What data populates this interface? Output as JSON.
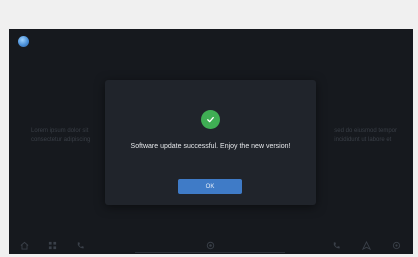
{
  "background": {
    "left_text": [
      "Lorem ipsum dolor sit",
      "consectetur adipiscing"
    ],
    "right_text": [
      "sed do eiusmod tempor",
      "incididunt ut labore et"
    ]
  },
  "dialog": {
    "icon": "check-circle-icon",
    "message": "Software update successful. Enjoy the new version!",
    "ok_label": "OK"
  },
  "bottom_bar": {
    "icons": [
      "home-icon",
      "grid-icon",
      "phone-icon",
      "circle-dot-icon",
      "call-icon",
      "navigation-icon",
      "settings-icon"
    ]
  },
  "colors": {
    "screen_bg": "#16191e",
    "dialog_bg": "#20242b",
    "success_green": "#3fae54",
    "button_blue": "#3f7bc7"
  }
}
